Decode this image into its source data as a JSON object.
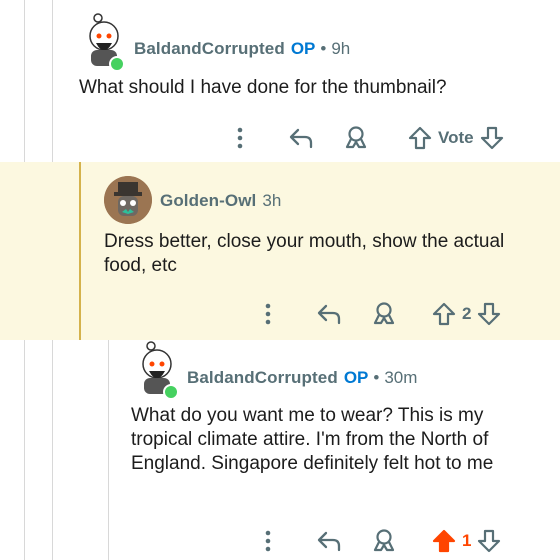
{
  "comments": [
    {
      "username": "BaldandCorrupted",
      "op_label": "OP",
      "separator": "•",
      "time": "9h",
      "body": "What should I have done for the thumbnail?",
      "vote_label": "Vote",
      "online": true
    },
    {
      "username": "Golden-Owl",
      "time": "3h",
      "body": "Dress better, close your mouth, show the actual food, etc",
      "vote_count": "2",
      "highlighted": true
    },
    {
      "username": "BaldandCorrupted",
      "op_label": "OP",
      "separator": "•",
      "time": "30m",
      "body": "What do you want me to wear? This is my tropical climate attire. I'm from the North of England. Singapore definitely felt hot to me",
      "vote_count": "1",
      "upvoted": true,
      "online": true
    }
  ],
  "colors": {
    "upvote_active": "#ff4500",
    "op": "#0079d3",
    "highlight_bg": "#fcf8e0",
    "accent_bar": "#d4b24c",
    "online": "#46d160"
  },
  "icons": [
    "snoo-avatar-icon",
    "owl-avatar-icon",
    "more-icon",
    "reply-icon",
    "award-icon",
    "upvote-icon",
    "downvote-icon"
  ]
}
